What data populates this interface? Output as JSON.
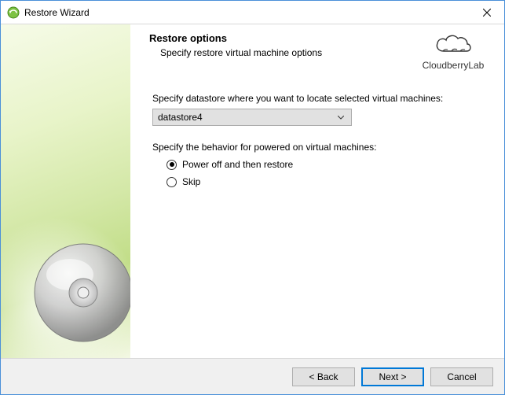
{
  "window": {
    "title": "Restore Wizard"
  },
  "brand": {
    "name": "CloudberryLab"
  },
  "header": {
    "title": "Restore options",
    "subtitle": "Specify restore virtual machine options"
  },
  "form": {
    "datastore_label": "Specify datastore where you want to locate selected virtual machines:",
    "datastore_value": "datastore4",
    "behavior_label": "Specify the behavior for powered on virtual machines:",
    "radios": {
      "poweroff": "Power off and then restore",
      "skip": "Skip"
    },
    "selected_radio": "poweroff"
  },
  "footer": {
    "back": "< Back",
    "next": "Next >",
    "cancel": "Cancel"
  }
}
